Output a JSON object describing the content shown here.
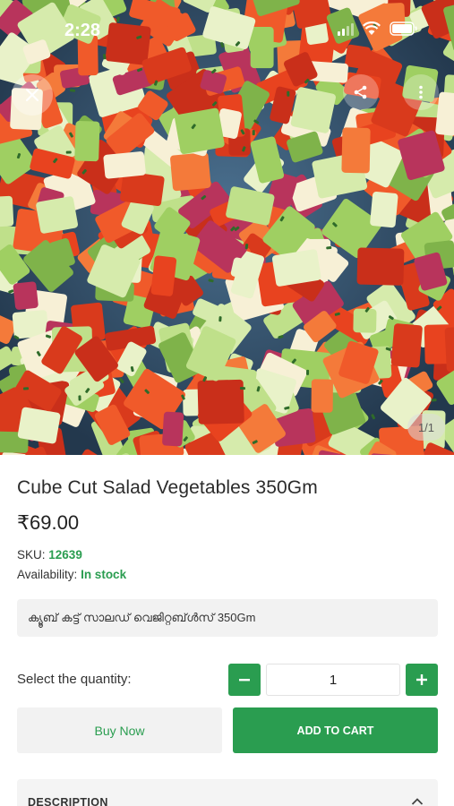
{
  "status_bar": {
    "time": "2:28"
  },
  "gallery": {
    "indicator": "1/1"
  },
  "product": {
    "title": "Cube Cut Salad Vegetables 350Gm",
    "price": "₹69.00",
    "sku_label": "SKU:",
    "sku_value": "12639",
    "availability_label": "Availability:",
    "availability_value": "In stock",
    "native_name": "ക്യൂബ് കട്ട് സാലഡ് വെജിറ്റബ്ൾസ് 350Gm"
  },
  "quantity": {
    "label": "Select the quantity:",
    "value": "1"
  },
  "actions": {
    "buy_now": "Buy Now",
    "add_to_cart": "ADD TO CART"
  },
  "description": {
    "label": "DESCRIPTION"
  },
  "icons": {
    "close": "close-icon",
    "share": "share-icon",
    "more": "more-vertical-icon",
    "minus": "minus-icon",
    "plus": "plus-icon",
    "chevron": "chevron-up-icon"
  },
  "colors": {
    "accent": "#2a9d50",
    "tomato": "#e8431f",
    "cucumber": "#b9dc7e"
  }
}
